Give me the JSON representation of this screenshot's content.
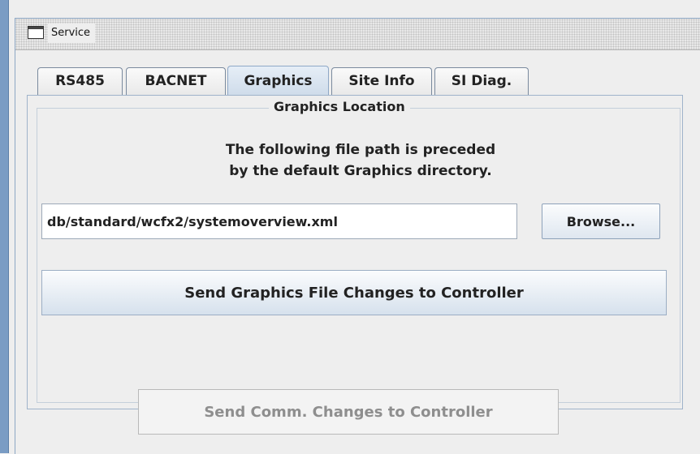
{
  "window": {
    "title": "Service"
  },
  "tabs": [
    {
      "label": "RS485"
    },
    {
      "label": "BACNET"
    },
    {
      "label": "Graphics",
      "active": true
    },
    {
      "label": "Site Info"
    },
    {
      "label": "SI Diag."
    }
  ],
  "graphics": {
    "group_title": "Graphics Location",
    "description_line1": "The following file path is preceded",
    "description_line2": "by the default Graphics directory.",
    "file_path": "db/standard/wcfx2/systemoverview.xml",
    "browse_label": "Browse...",
    "send_graphics_label": "Send Graphics File Changes to Controller"
  },
  "footer": {
    "send_comm_label": "Send Comm. Changes to Controller",
    "send_comm_enabled": false
  },
  "colors": {
    "window_bg": "#eeeeee",
    "frame_blue": "#7a9cc4",
    "active_tab": "#cfdcea",
    "disabled_text": "#8e8e8e"
  }
}
